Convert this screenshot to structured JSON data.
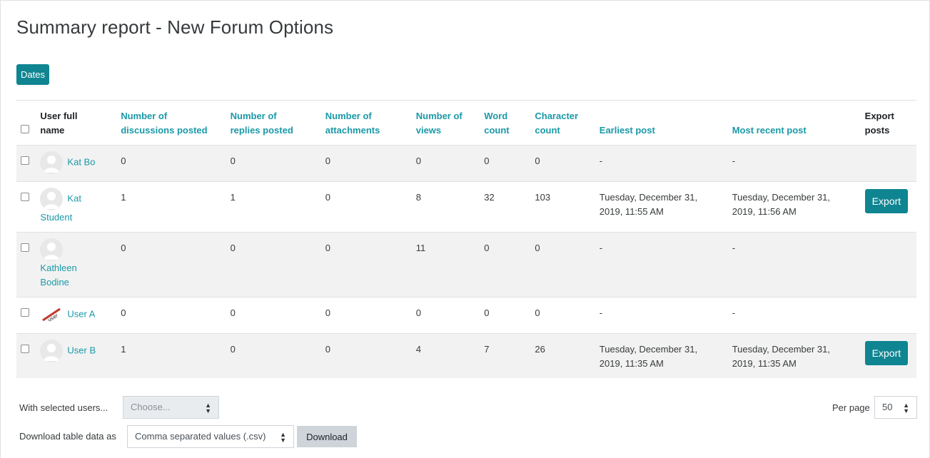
{
  "page": {
    "title": "Summary report - New Forum Options",
    "dates_button": "Dates"
  },
  "table": {
    "headers": {
      "user": [
        "User full",
        "name"
      ],
      "discussions": [
        "Number of",
        "discussions posted"
      ],
      "replies": [
        "Number of",
        "replies posted"
      ],
      "attachments": [
        "Number of",
        "attachments"
      ],
      "views": [
        "Number of",
        "views"
      ],
      "word": [
        "Word",
        "count"
      ],
      "char": [
        "Character",
        "count"
      ],
      "earliest": "Earliest post",
      "recent": "Most recent post",
      "export": [
        "Export",
        "posts"
      ]
    },
    "export_label": "Export",
    "rows": [
      {
        "name": "Kat Bo",
        "name_lines": [
          "Kat Bo"
        ],
        "discussions": "0",
        "replies": "0",
        "attachments": "0",
        "views": "0",
        "words": "0",
        "chars": "0",
        "earliest": [
          "-"
        ],
        "recent": [
          "-"
        ],
        "export": false,
        "avatar": "default-avatar-icon"
      },
      {
        "name": "Kat Student",
        "name_lines": [
          "Kat",
          "Student"
        ],
        "discussions": "1",
        "replies": "1",
        "attachments": "0",
        "views": "8",
        "words": "32",
        "chars": "103",
        "earliest": [
          "Tuesday, December 31,",
          "2019, 11:55 AM"
        ],
        "recent": [
          "Tuesday, December 31,",
          "2019, 11:56 AM"
        ],
        "export": true,
        "avatar": "default-avatar-icon"
      },
      {
        "name": "Kathleen Bodine",
        "name_lines": [
          "Kathleen",
          "Bodine"
        ],
        "discussions": "0",
        "replies": "0",
        "attachments": "0",
        "views": "11",
        "words": "0",
        "chars": "0",
        "earliest": [
          "-"
        ],
        "recent": [
          "-"
        ],
        "export": false,
        "avatar": "default-avatar-icon"
      },
      {
        "name": "User A",
        "name_lines": [
          "User A"
        ],
        "discussions": "0",
        "replies": "0",
        "attachments": "0",
        "views": "0",
        "words": "0",
        "chars": "0",
        "earliest": [
          "-"
        ],
        "recent": [
          "-"
        ],
        "export": false,
        "avatar": "custom-user-avatar-icon"
      },
      {
        "name": "User B",
        "name_lines": [
          "User B"
        ],
        "discussions": "1",
        "replies": "0",
        "attachments": "0",
        "views": "4",
        "words": "7",
        "chars": "26",
        "earliest": [
          "Tuesday, December 31,",
          "2019, 11:35 AM"
        ],
        "recent": [
          "Tuesday, December 31,",
          "2019, 11:35 AM"
        ],
        "export": true,
        "avatar": "default-avatar-icon"
      }
    ]
  },
  "bulk": {
    "label": "With selected users...",
    "select_value": "Choose..."
  },
  "paging": {
    "label": "Per page",
    "value": "50"
  },
  "download": {
    "label": "Download table data as",
    "format_value": "Comma separated values (.csv)",
    "button": "Download"
  },
  "colors": {
    "accent": "#0f8591",
    "link": "#1a99a8",
    "row_stripe": "#f2f2f2"
  }
}
